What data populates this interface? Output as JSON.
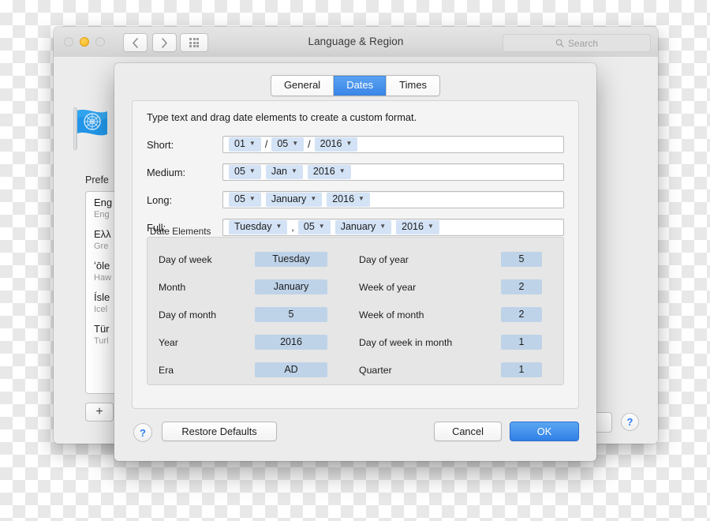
{
  "window": {
    "title": "Language & Region",
    "traffic_lights": [
      "close",
      "minimize",
      "zoom"
    ],
    "nav": {
      "back": "back-chevron",
      "forward": "forward-chevron",
      "show_all": "grid-icon"
    },
    "search": {
      "placeholder": "Search",
      "icon": "search-icon"
    },
    "flag_icon": "un-flag-icon",
    "preferred_label": "Prefe",
    "languages": [
      {
        "native": "Eng",
        "english": "Eng"
      },
      {
        "native": "Ελλ",
        "english": "Gre"
      },
      {
        "native": "ʻōle",
        "english": "Haw"
      },
      {
        "native": "Ísle",
        "english": "Icel"
      },
      {
        "native": "Tür",
        "english": "Turl"
      }
    ],
    "add_button": "+",
    "help_button": "?"
  },
  "sheet": {
    "tabs": [
      {
        "label": "General",
        "active": false
      },
      {
        "label": "Dates",
        "active": true
      },
      {
        "label": "Times",
        "active": false
      }
    ],
    "instructions": "Type text and drag date elements to create a custom format.",
    "formats": [
      {
        "label": "Short:",
        "parts": [
          {
            "kind": "token",
            "text": "01"
          },
          {
            "kind": "sep",
            "text": "/"
          },
          {
            "kind": "token",
            "text": "05"
          },
          {
            "kind": "sep",
            "text": "/"
          },
          {
            "kind": "token",
            "text": "2016"
          }
        ]
      },
      {
        "label": "Medium:",
        "parts": [
          {
            "kind": "token",
            "text": "05"
          },
          {
            "kind": "token",
            "text": "Jan"
          },
          {
            "kind": "token",
            "text": "2016"
          }
        ]
      },
      {
        "label": "Long:",
        "parts": [
          {
            "kind": "token",
            "text": "05"
          },
          {
            "kind": "token",
            "text": "January"
          },
          {
            "kind": "token",
            "text": "2016"
          }
        ]
      },
      {
        "label": "Full:",
        "parts": [
          {
            "kind": "token",
            "text": "Tuesday"
          },
          {
            "kind": "sep",
            "text": ","
          },
          {
            "kind": "token",
            "text": "05"
          },
          {
            "kind": "token",
            "text": "January"
          },
          {
            "kind": "token",
            "text": "2016"
          }
        ]
      }
    ],
    "date_elements": {
      "group_label": "Date Elements",
      "left": [
        {
          "label": "Day of week",
          "value": "Tuesday"
        },
        {
          "label": "Month",
          "value": "January"
        },
        {
          "label": "Day of month",
          "value": "5"
        },
        {
          "label": "Year",
          "value": "2016"
        },
        {
          "label": "Era",
          "value": "AD"
        }
      ],
      "right": [
        {
          "label": "Day of year",
          "value": "5"
        },
        {
          "label": "Week of year",
          "value": "2"
        },
        {
          "label": "Week of month",
          "value": "2"
        },
        {
          "label": "Day of week in month",
          "value": "1"
        },
        {
          "label": "Quarter",
          "value": "1"
        }
      ]
    },
    "footer": {
      "help": "?",
      "restore": "Restore Defaults",
      "cancel": "Cancel",
      "ok": "OK"
    }
  },
  "colors": {
    "accent_blue": "#2f7fe6",
    "tab_active_blue": "#3a86e8",
    "token_blue": "#d3e3f5",
    "element_token_blue": "#bed3e8",
    "help_blue": "#2b7cf7",
    "minimize_amber": "#f7b621"
  }
}
